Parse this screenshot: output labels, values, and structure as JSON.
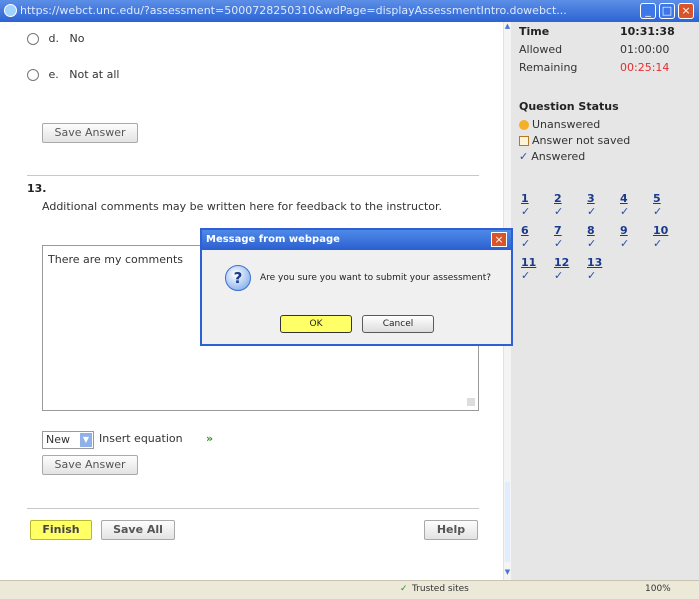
{
  "window": {
    "title": "https://webct.unc.edu/?assessment=5000728250310&wdPage=displayAssessmentIntro.dowebct... ",
    "minimize": "_",
    "maximize": "□",
    "close": "×"
  },
  "question_prev": {
    "options": [
      {
        "letter": "d.",
        "text": "No"
      },
      {
        "letter": "e.",
        "text": "Not at all"
      }
    ],
    "save_label": "Save Answer"
  },
  "question13": {
    "number": "13.",
    "prompt": "Additional comments may be written here for feedback to the instructor.",
    "answer_text": "There are my comments",
    "format_select": "New",
    "insert_equation": "Insert equation",
    "insert_arrow": "»",
    "save_label": "Save Answer"
  },
  "footer": {
    "finish_label": "Finish",
    "save_all_label": "Save All",
    "help_label": "Help"
  },
  "sidebar": {
    "time_label": "Time",
    "time_value": "10:31:38",
    "allowed_label": "Allowed",
    "allowed_value": "01:00:00",
    "remaining_label": "Remaining",
    "remaining_value": "00:25:14",
    "status_heading": "Question Status",
    "legend": [
      {
        "icon": "unanswered-icon",
        "label": "Unanswered"
      },
      {
        "icon": "not-saved-icon",
        "label": "Answer not saved"
      },
      {
        "icon": "answered-icon",
        "label": "Answered"
      }
    ],
    "questions": [
      "1",
      "2",
      "3",
      "4",
      "5",
      "6",
      "7",
      "8",
      "9",
      "10",
      "11",
      "12",
      "13"
    ],
    "check": "✓"
  },
  "dialog": {
    "title": "Message from webpage",
    "message": "Are you sure you want to submit your assessment?",
    "ok_label": "OK",
    "cancel_label": "Cancel",
    "close": "×",
    "icon_glyph": "?"
  },
  "statusbar": {
    "trusted": "Trusted sites",
    "zoom": "100%",
    "check": "✓"
  },
  "colors": {
    "remaining": "#e03030",
    "highlight": "#ffff66",
    "dialog_title": "#2b5fd0"
  }
}
